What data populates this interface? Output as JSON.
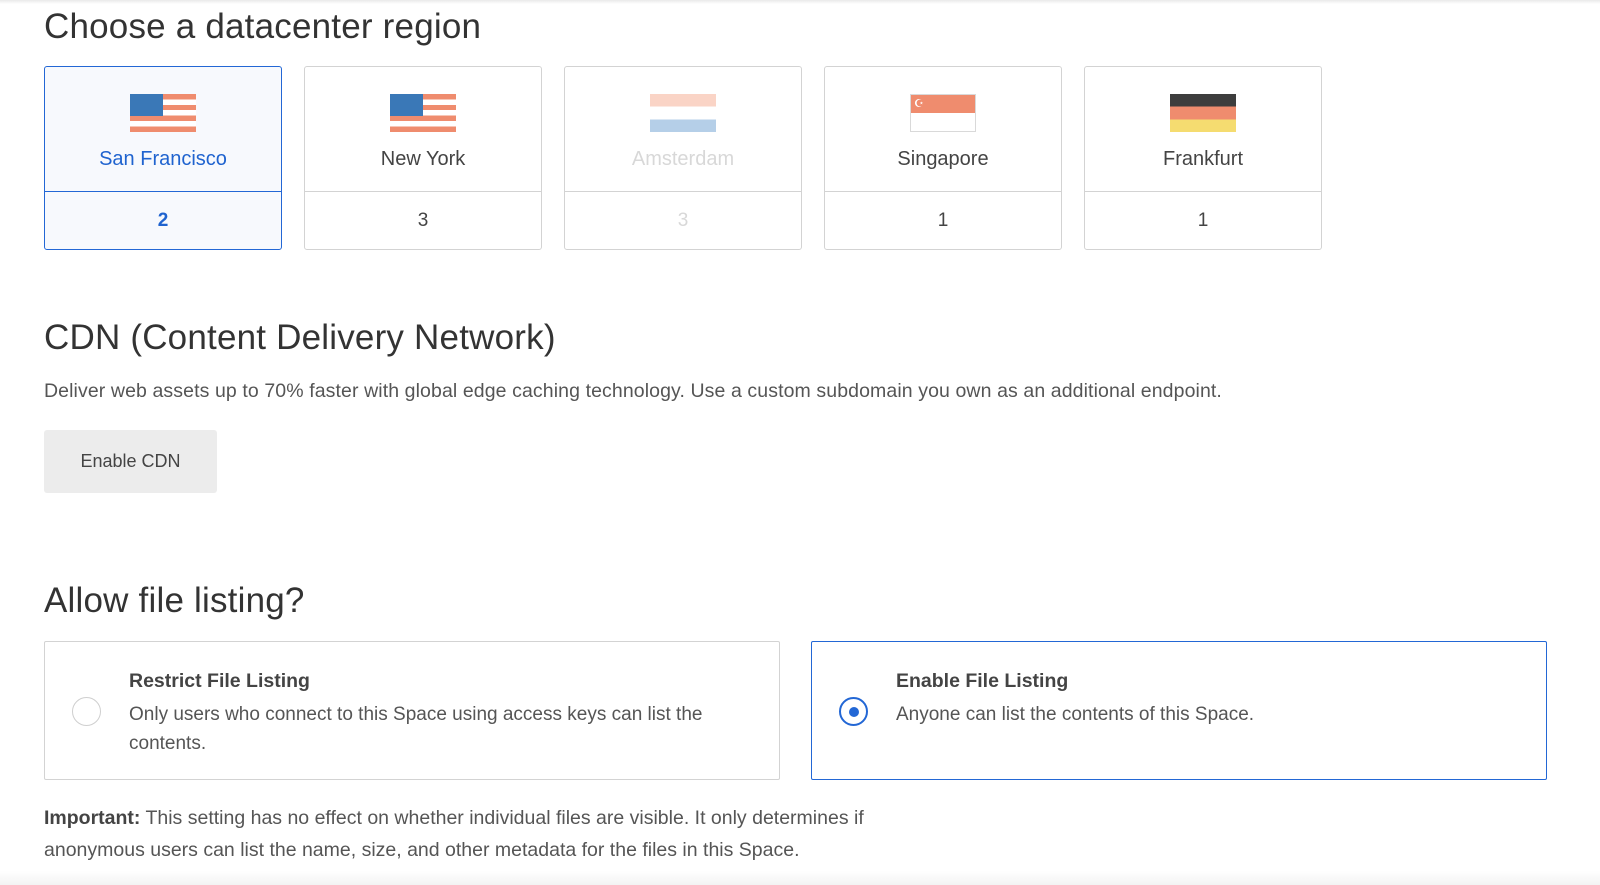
{
  "region_section": {
    "title": "Choose a datacenter region",
    "regions": [
      {
        "name": "San Francisco",
        "count": "2",
        "flag": "us-flag-icon",
        "state": "selected"
      },
      {
        "name": "New York",
        "count": "3",
        "flag": "us-flag-icon",
        "state": "available"
      },
      {
        "name": "Amsterdam",
        "count": "3",
        "flag": "netherlands-flag-icon",
        "state": "disabled"
      },
      {
        "name": "Singapore",
        "count": "1",
        "flag": "singapore-flag-icon",
        "state": "available"
      },
      {
        "name": "Frankfurt",
        "count": "1",
        "flag": "germany-flag-icon",
        "state": "available"
      }
    ]
  },
  "cdn_section": {
    "title": "CDN (Content Delivery Network)",
    "description": "Deliver web assets up to 70% faster with global edge caching technology. Use a custom subdomain you own as an additional endpoint.",
    "button_label": "Enable CDN"
  },
  "listing_section": {
    "title": "Allow file listing?",
    "options": [
      {
        "title": "Restrict File Listing",
        "description": "Only users who connect to this Space using access keys can list the contents.",
        "selected": false
      },
      {
        "title": "Enable File Listing",
        "description": "Anyone can list the contents of this Space.",
        "selected": true
      }
    ],
    "note_label": "Important:",
    "note_text": " This setting has no effect on whether individual files are visible. It only determines if anonymous users can list the name, size, and other metadata for the files in this Space."
  },
  "colors": {
    "accent": "#2367d5",
    "selected_bg": "#f7f9fd",
    "border": "#d3d3d3",
    "button_bg": "#ececec"
  }
}
